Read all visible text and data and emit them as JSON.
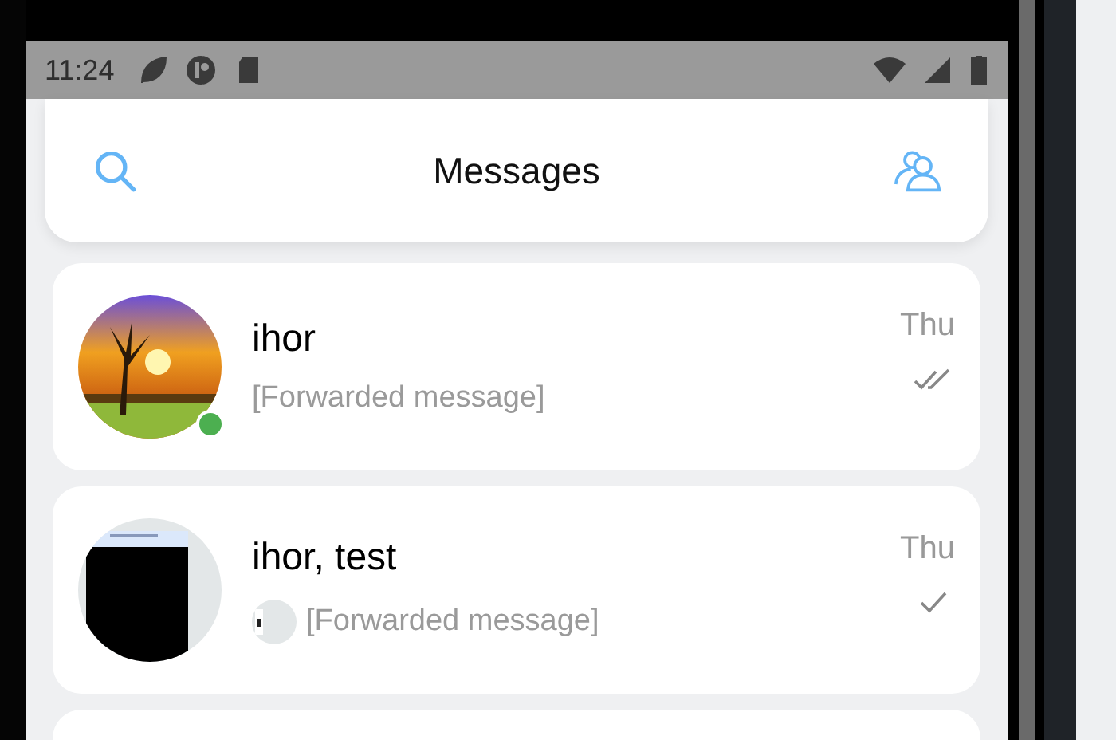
{
  "status_bar": {
    "time": "11:24"
  },
  "header": {
    "title": "Messages"
  },
  "chats": [
    {
      "name": "ihor",
      "preview": "[Forwarded message]",
      "time": "Thu",
      "online": true,
      "read": true,
      "preview_avatar": false
    },
    {
      "name": "ihor, test",
      "preview": "[Forwarded message]",
      "time": "Thu",
      "online": false,
      "read": false,
      "preview_avatar": true
    }
  ]
}
